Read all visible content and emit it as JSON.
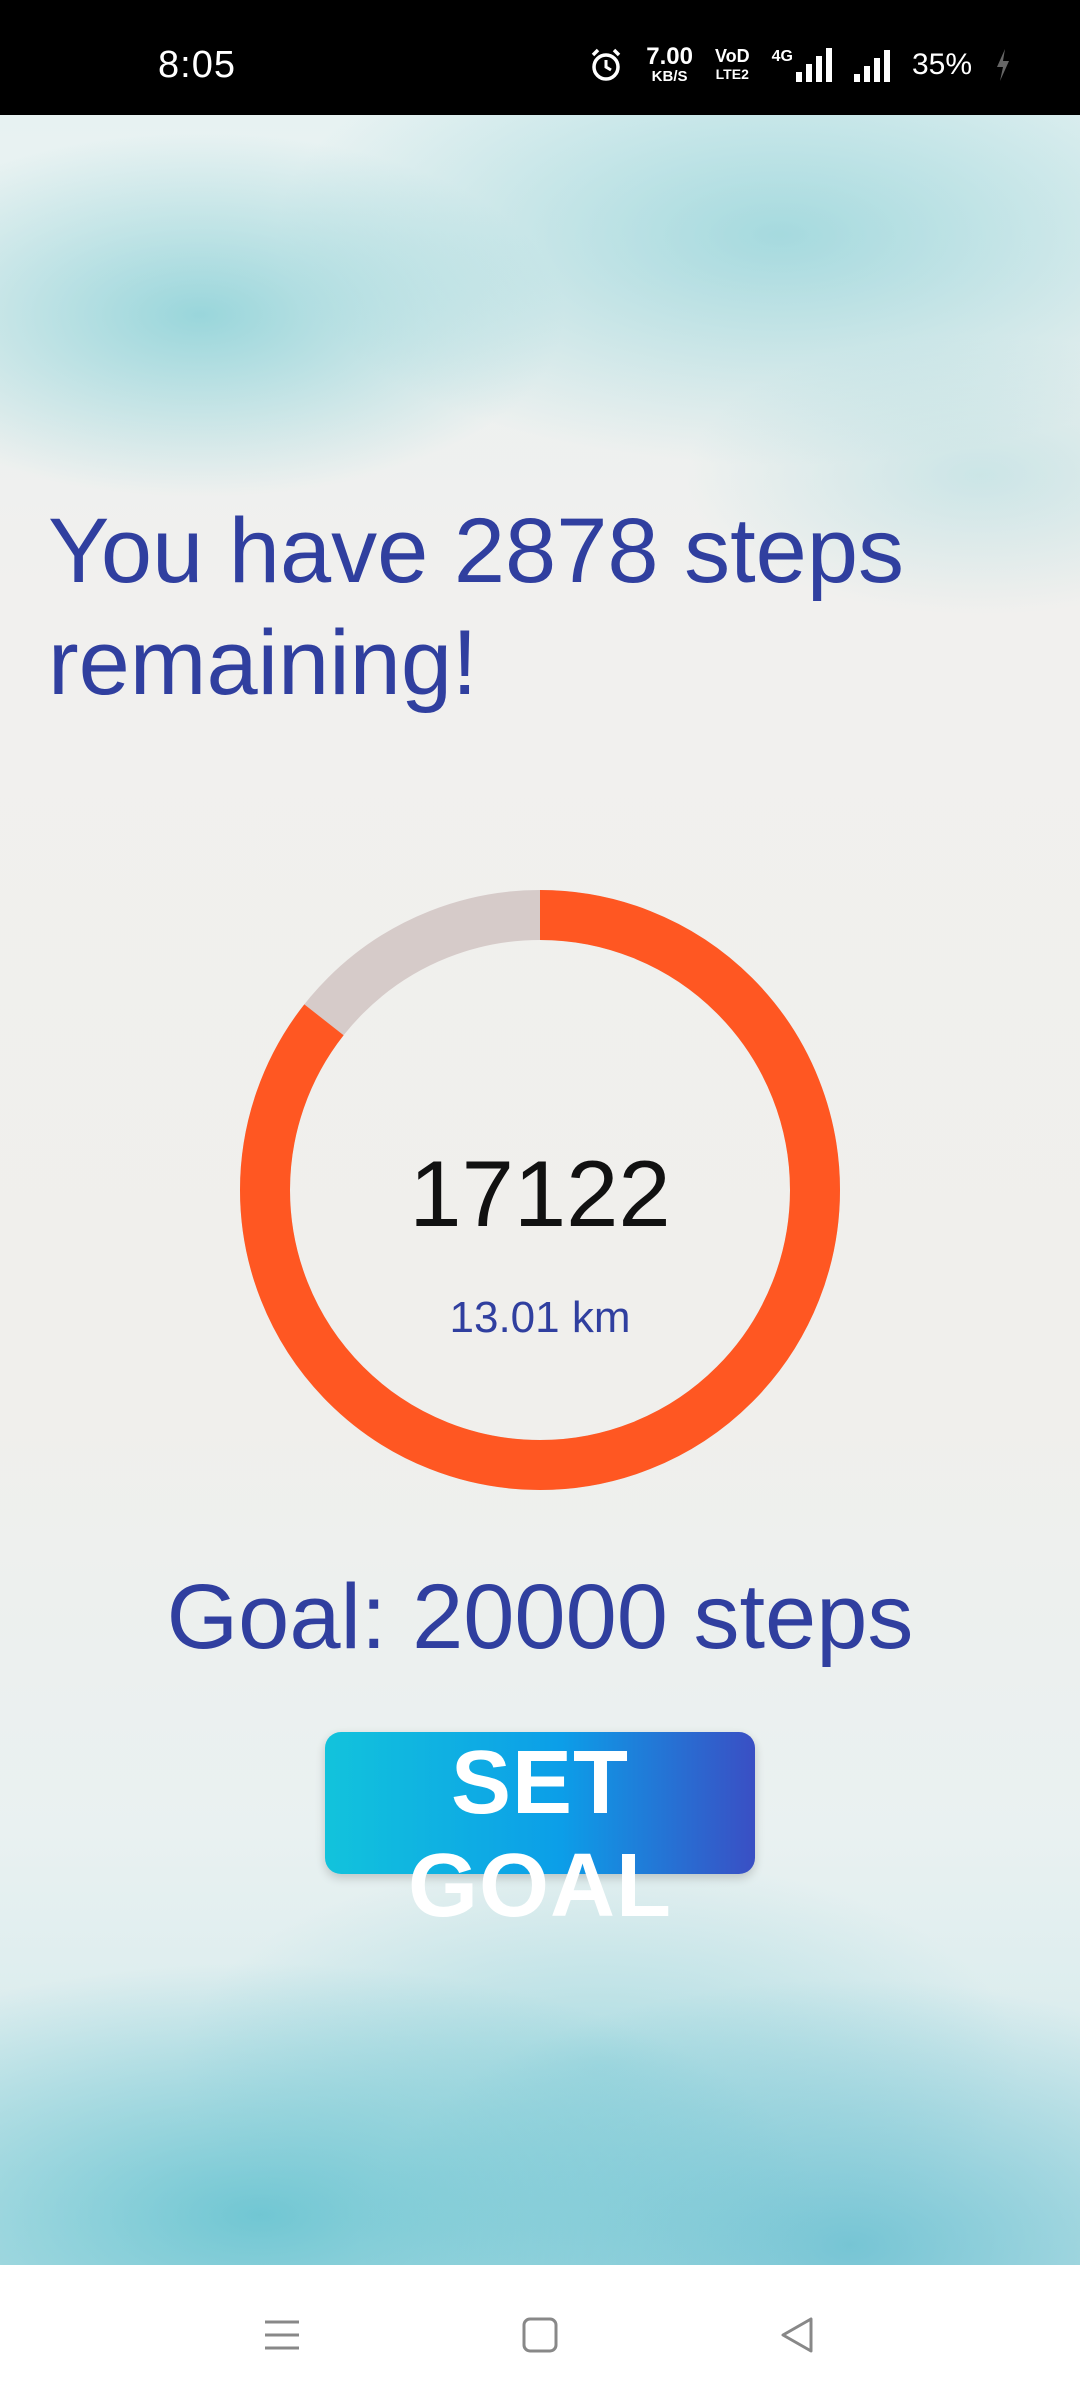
{
  "status_bar": {
    "time": "8:05",
    "speed_value": "7.00",
    "speed_unit": "KB/S",
    "volte_top": "VoD",
    "volte_bottom": "LTE2",
    "network": "4G",
    "battery": "35%",
    "icons": [
      "alarm-icon",
      "signal-icon",
      "charging-icon"
    ]
  },
  "main": {
    "headline": "You have 2878 steps remaining!",
    "steps": "17122",
    "distance": "13.01 km",
    "goal_label": "Goal: 20000 steps",
    "set_goal_label": "SET GOAL"
  },
  "progress": {
    "steps": 17122,
    "goal": 20000,
    "fraction": 0.8561,
    "color_progress": "#ff5722",
    "color_track": "#d6cbc9"
  },
  "colors": {
    "primary_text": "#303f9f",
    "button_gradient_start": "#12c3dc",
    "button_gradient_end": "#3a4fc4"
  },
  "nav_bar": {
    "icons": [
      "menu-icon",
      "home-icon",
      "back-icon"
    ]
  }
}
